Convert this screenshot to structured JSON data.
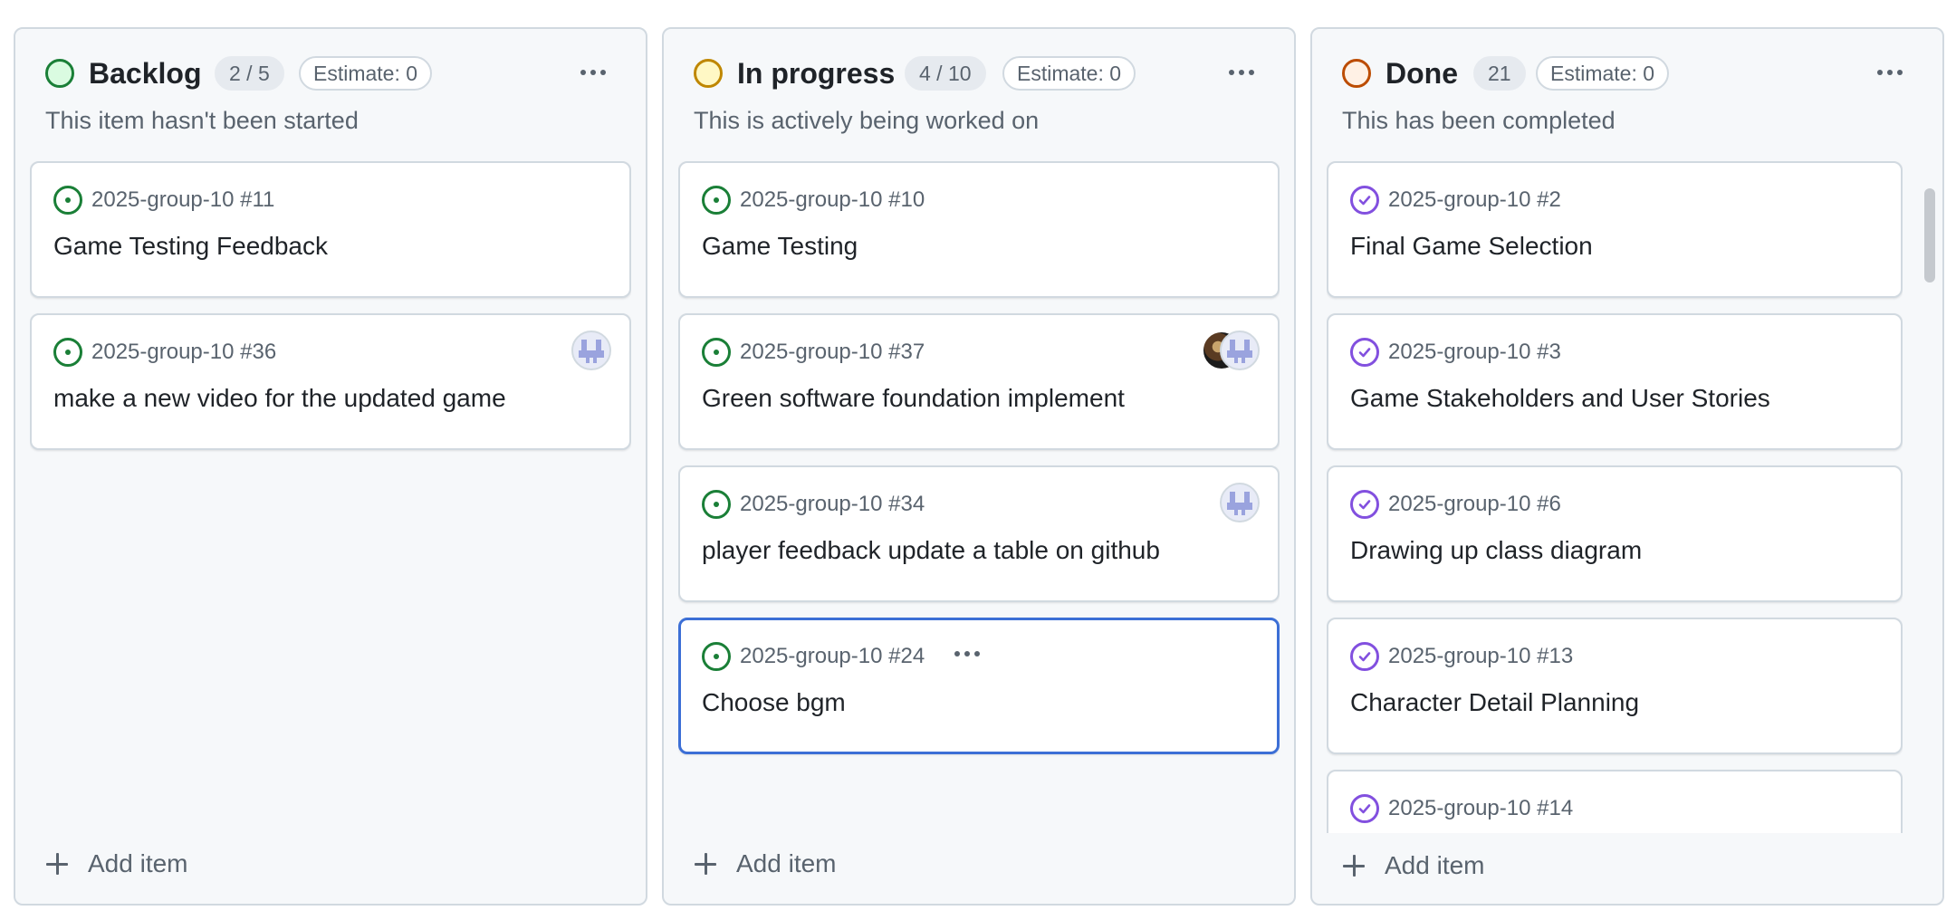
{
  "columns": [
    {
      "title": "Backlog",
      "count": "2 / 5",
      "estimate": "Estimate: 0",
      "description": "This item hasn't been started",
      "status_color": "#1a7f37",
      "add_item": "Add item",
      "cards": [
        {
          "ref": "2025-group-10 #11",
          "title": "Game Testing Feedback",
          "state": "open"
        },
        {
          "ref": "2025-group-10 #36",
          "title": "make a new video for the updated game",
          "state": "open",
          "assignee": "avatar-icon"
        }
      ]
    },
    {
      "title": "In progress",
      "count": "4 / 10",
      "estimate": "Estimate: 0",
      "description": "This is actively being worked on",
      "status_color": "#bf8700",
      "add_item": "Add item",
      "cards": [
        {
          "ref": "2025-group-10 #10",
          "title": "Game Testing",
          "state": "open"
        },
        {
          "ref": "2025-group-10 #37",
          "title": "Green software foundation implement",
          "state": "open",
          "assignee": "two-avatars"
        },
        {
          "ref": "2025-group-10 #34",
          "title": "player feedback update a table on github",
          "state": "open",
          "assignee": "avatar-icon"
        },
        {
          "ref": "2025-group-10 #24",
          "title": "Choose bgm",
          "state": "open",
          "selected": true
        }
      ]
    },
    {
      "title": "Done",
      "count": "21",
      "estimate": "Estimate: 0",
      "description": "This has been completed",
      "status_color": "#bc4c00",
      "add_item": "Add item",
      "cards": [
        {
          "ref": "2025-group-10 #2",
          "title": "Final Game Selection",
          "state": "closed"
        },
        {
          "ref": "2025-group-10 #3",
          "title": "Game Stakeholders and User Stories",
          "state": "closed"
        },
        {
          "ref": "2025-group-10 #6",
          "title": "Drawing up class diagram",
          "state": "closed"
        },
        {
          "ref": "2025-group-10 #13",
          "title": "Character Detail Planning",
          "state": "closed"
        },
        {
          "ref": "2025-group-10 #14",
          "title": "",
          "state": "closed"
        }
      ]
    }
  ]
}
